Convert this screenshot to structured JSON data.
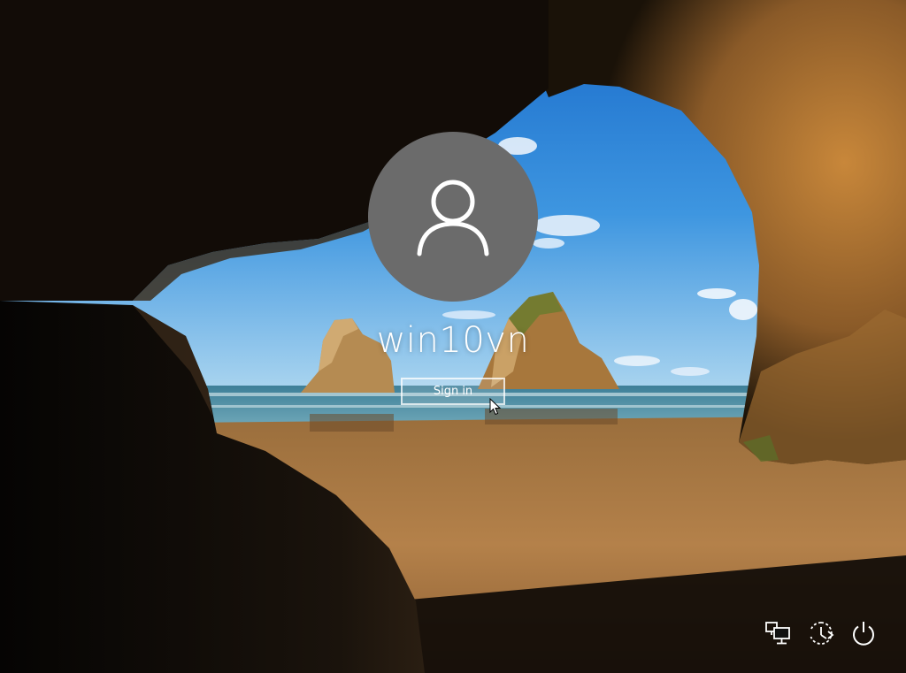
{
  "lock_screen": {
    "username": "win10vn",
    "sign_in_label": "Sign in"
  },
  "icons": {
    "avatar": "user-silhouette-icon",
    "network": "network-icon",
    "ease_of_access": "ease-of-access-icon",
    "power": "power-icon"
  },
  "colors": {
    "avatar_bg": "#6b6b6b",
    "text": "#ffffff"
  }
}
